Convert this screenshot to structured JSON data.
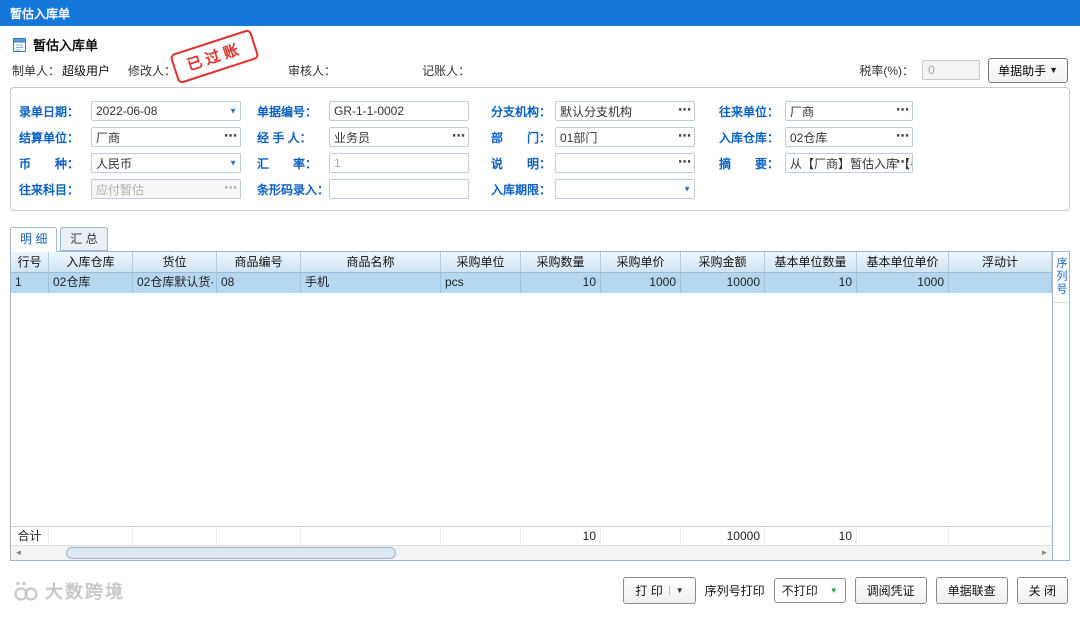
{
  "window": {
    "title": "暂估入库单"
  },
  "page": {
    "title": "暂估入库单"
  },
  "meta": {
    "maker_label": "制单人：",
    "maker_value": "超级用户",
    "modifier_label": "修改人：",
    "stamp": "已过账",
    "auditor_label": "审核人：",
    "bookkeeper_label": "记账人：",
    "tax_label": "税率(%)：",
    "tax_value": "0",
    "assistant_button": "单据助手"
  },
  "icons": {
    "dropdown": "▼",
    "lookup": "⋯",
    "scroll_left": "◄",
    "scroll_right": "►"
  },
  "form": {
    "fields": [
      {
        "label": "录单日期：",
        "value": "2022-06-08"
      },
      {
        "label": "单据编号：",
        "value": "GR-1-1-0002"
      },
      {
        "label": "分支机构：",
        "value": "默认分支机构"
      },
      {
        "label": "往来单位：",
        "value": "厂商"
      },
      {
        "label": "结算单位：",
        "value": "厂商"
      },
      {
        "label": "经 手 人：",
        "value": "业务员"
      },
      {
        "label": "部　　门：",
        "value": "01部门"
      },
      {
        "label": "入库仓库：",
        "value": "02仓库"
      },
      {
        "label": "币　　种：",
        "value": "人民币"
      },
      {
        "label": "汇　　率：",
        "value": "1"
      },
      {
        "label": "说　　明：",
        "value": ""
      },
      {
        "label": "摘　　要：",
        "value": "从【厂商】暂估入库【手"
      },
      {
        "label": "往来科目：",
        "value": "应付暂估"
      },
      {
        "label": "条形码录入：",
        "value": ""
      },
      {
        "label": "入库期限：",
        "value": ""
      }
    ]
  },
  "tabs": {
    "detail": "明 细",
    "summary": "汇 总"
  },
  "table": {
    "headers": [
      "行号",
      "入库仓库",
      "货位",
      "商品编号",
      "商品名称",
      "采购单位",
      "采购数量",
      "采购单价",
      "采购金额",
      "基本单位数量",
      "基本单位单价",
      "浮动计"
    ],
    "serial_header": "序列号",
    "rows": [
      [
        "1",
        "02仓库",
        "02仓库默认货·",
        "08",
        "手机",
        "pcs",
        "10",
        "1000",
        "10000",
        "10",
        "1000",
        ""
      ]
    ],
    "total": [
      "合计",
      "",
      "",
      "",
      "",
      "",
      "10",
      "",
      "10000",
      "10",
      "",
      ""
    ]
  },
  "footer": {
    "logo_text": "大数跨境",
    "print_button": "打 印",
    "serial_print_label": "序列号打印",
    "serial_print_value": "不打印",
    "voucher_button": "调阅凭证",
    "doclink_button": "单据联查",
    "close_button": "关 闭"
  }
}
